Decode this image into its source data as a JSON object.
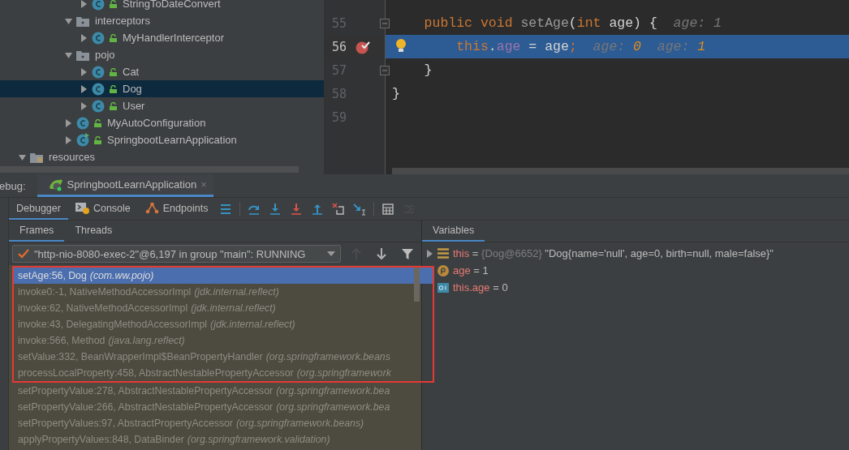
{
  "project_tree": [
    {
      "kind": "continuation",
      "children": [
        {
          "kind": "continuation",
          "children": [
            {
              "kind": "continuation",
              "children": [
                {
                  "kind": "continuation",
                  "children": [
                    {
                      "kind": "class",
                      "label": "StringToDateConvert",
                      "expanded": false,
                      "selected": false
                    }
                  ]
                },
                {
                  "kind": "package",
                  "label": "interceptors",
                  "expanded": true,
                  "selected": false,
                  "children": [
                    {
                      "kind": "class",
                      "label": "MyHandlerInterceptor",
                      "expanded": false,
                      "selected": false
                    }
                  ]
                },
                {
                  "kind": "package",
                  "label": "pojo",
                  "expanded": true,
                  "selected": false,
                  "children": [
                    {
                      "kind": "class",
                      "label": "Cat",
                      "expanded": false,
                      "selected": false
                    },
                    {
                      "kind": "class",
                      "label": "Dog",
                      "expanded": false,
                      "selected": true
                    },
                    {
                      "kind": "class",
                      "label": "User",
                      "expanded": false,
                      "selected": false
                    }
                  ]
                },
                {
                  "kind": "class",
                  "label": "MyAutoConfiguration",
                  "expanded": false,
                  "selected": false
                },
                {
                  "kind": "app",
                  "label": "SpringbootLearnApplication",
                  "expanded": false,
                  "selected": false
                }
              ]
            }
          ]
        }
      ]
    },
    {
      "kind": "resources",
      "label": "resources",
      "expanded": true,
      "selected": false
    }
  ],
  "editor": {
    "lines": [
      {
        "number": "55",
        "current": false,
        "breakpoint": false,
        "fold": true,
        "intention": false,
        "tokens": [
          {
            "kind": "kw",
            "text": "    public void "
          },
          {
            "kind": "name",
            "text": "setAge"
          },
          {
            "kind": "plain",
            "text": "("
          },
          {
            "kind": "kw",
            "text": "int "
          },
          {
            "kind": "plain",
            "text": "age) {  "
          },
          {
            "kind": "hint",
            "text": "age: 1"
          }
        ]
      },
      {
        "number": "56",
        "current": true,
        "breakpoint": true,
        "fold": false,
        "intention": true,
        "tokens": [
          {
            "kind": "kw",
            "text": "        this"
          },
          {
            "kind": "plain",
            "text": "."
          },
          {
            "kind": "field",
            "text": "age"
          },
          {
            "kind": "plain",
            "text": " = age"
          },
          {
            "kind": "kw",
            "text": ";"
          },
          {
            "kind": "hint",
            "text": "  age: "
          },
          {
            "kind": "hint-changed",
            "text": "0"
          },
          {
            "kind": "hint",
            "text": "  age: "
          },
          {
            "kind": "hint-changed",
            "text": "1"
          }
        ]
      },
      {
        "number": "57",
        "current": false,
        "breakpoint": false,
        "fold": true,
        "intention": false,
        "tokens": [
          {
            "kind": "plain",
            "text": "    }"
          }
        ]
      },
      {
        "number": "58",
        "current": false,
        "breakpoint": false,
        "fold": false,
        "intention": false,
        "tokens": [
          {
            "kind": "plain",
            "text": "}"
          }
        ]
      },
      {
        "number": "59",
        "current": false,
        "breakpoint": false,
        "fold": false,
        "intention": false
      }
    ]
  },
  "debug": {
    "label": "ebug:",
    "session_tab": {
      "label": "SpringbootLearnApplication",
      "close": "×",
      "selected": true
    },
    "tool_tabs": [
      {
        "kind": "debugger",
        "label": "Debugger",
        "selected": true
      },
      {
        "kind": "console",
        "label": "Console",
        "selected": false
      },
      {
        "kind": "endpoints",
        "label": "Endpoints",
        "selected": false
      }
    ],
    "toolbar": [
      {
        "kind": "menu",
        "disabled": false
      },
      {
        "kind": "step-over",
        "disabled": false
      },
      {
        "kind": "step-into",
        "disabled": false
      },
      {
        "kind": "force-step-into",
        "disabled": false
      },
      {
        "kind": "step-out",
        "disabled": false
      },
      {
        "kind": "drop-frame",
        "disabled": false
      },
      {
        "kind": "run-to-cursor",
        "disabled": false
      },
      {
        "kind": "evaluate",
        "disabled": false
      },
      {
        "kind": "trace",
        "disabled": true
      }
    ],
    "frame_tabs": [
      {
        "label": "Frames",
        "selected": true
      },
      {
        "label": "Threads",
        "selected": false
      }
    ],
    "thread": {
      "text": "\"http-nio-8080-exec-2\"@6,197 in group \"main\": RUNNING"
    },
    "frame_nav": [
      {
        "kind": "up",
        "disabled": true
      },
      {
        "kind": "down",
        "disabled": false
      },
      {
        "kind": "filter",
        "disabled": false
      }
    ],
    "frames": [
      {
        "method": "setAge:56, Dog",
        "package": "(com.ww.pojo)",
        "selected": true,
        "marked": true
      },
      {
        "method": "invoke0:-1, NativeMethodAccessorImpl",
        "package": "(jdk.internal.reflect)",
        "selected": false,
        "marked": true
      },
      {
        "method": "invoke:62, NativeMethodAccessorImpl",
        "package": "(jdk.internal.reflect)",
        "selected": false,
        "marked": true
      },
      {
        "method": "invoke:43, DelegatingMethodAccessorImpl",
        "package": "(jdk.internal.reflect)",
        "selected": false,
        "marked": true
      },
      {
        "method": "invoke:566, Method",
        "package": "(java.lang.reflect)",
        "selected": false,
        "marked": true
      },
      {
        "method": "setValue:332, BeanWrapperImpl$BeanPropertyHandler",
        "package": "(org.springframework.beans",
        "selected": false,
        "marked": true
      },
      {
        "method": "processLocalProperty:458, AbstractNestablePropertyAccessor",
        "package": "(org.springframework",
        "selected": false,
        "marked": true
      },
      {
        "method": "setPropertyValue:278, AbstractNestablePropertyAccessor",
        "package": "(org.springframework.bea",
        "selected": false,
        "marked": false
      },
      {
        "method": "setPropertyValue:266, AbstractNestablePropertyAccessor",
        "package": "(org.springframework.bea",
        "selected": false,
        "marked": false
      },
      {
        "method": "setPropertyValues:97, AbstractPropertyAccessor",
        "package": "(org.springframework.beans)",
        "selected": false,
        "marked": false
      },
      {
        "method": "applyPropertyValues:848, DataBinder",
        "package": "(org.springframework.validation)",
        "selected": false,
        "marked": false
      }
    ],
    "variables_tab": {
      "label": "Variables",
      "selected": true
    },
    "variables": [
      {
        "kind": "object",
        "name": "this",
        "sep": "=",
        "ref": "{Dog@6652}",
        "value": "\"Dog{name='null', age=0, birth=null, male=false}\""
      },
      {
        "kind": "param",
        "name": "age",
        "sep": "=",
        "value": "1"
      },
      {
        "kind": "field",
        "name": "this.age",
        "sep": "=",
        "value": "0"
      }
    ]
  }
}
